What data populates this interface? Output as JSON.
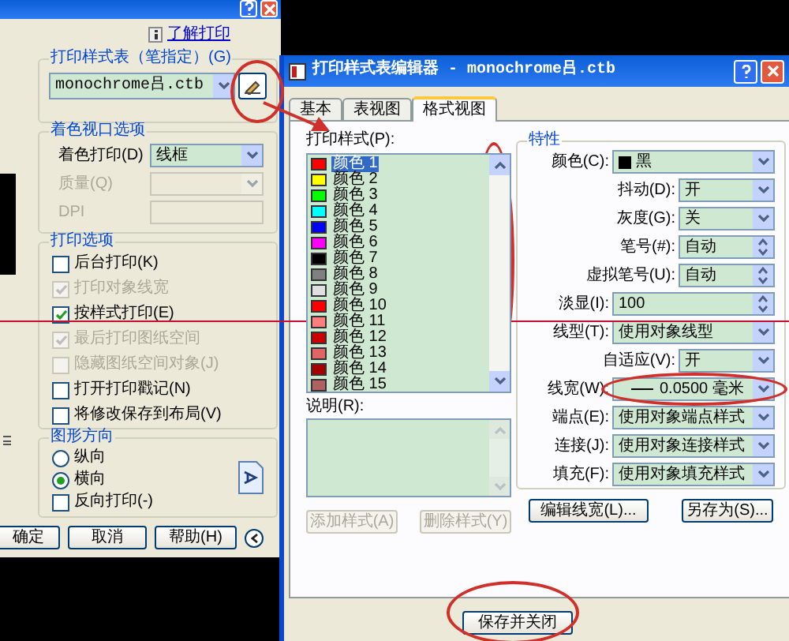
{
  "back_dialog": {
    "info_link": "了解打印",
    "plot_style_table": {
      "title": "打印样式表（笔指定）(G)",
      "value": "monochrome吕.ctb"
    },
    "shaded_viewport": {
      "title": "着色视口选项",
      "fields": [
        {
          "label": "着色打印(D)",
          "value": "线框",
          "disabled": false,
          "kind": "combo"
        },
        {
          "label": "质量(Q)",
          "disabled": true,
          "kind": "combo"
        },
        {
          "label": "DPI",
          "disabled": true,
          "kind": "text"
        }
      ]
    },
    "plot_options": {
      "title": "打印选项",
      "items": [
        {
          "label": "后台打印(K)",
          "checked": false,
          "disabled": false
        },
        {
          "label": "打印对象线宽",
          "checked": true,
          "disabled": true
        },
        {
          "label": "按样式打印(E)",
          "checked": true,
          "disabled": false
        },
        {
          "label": "最后打印图纸空间",
          "checked": true,
          "disabled": true
        },
        {
          "label": "隐藏图纸空间对象(J)",
          "checked": false,
          "disabled": true
        },
        {
          "label": "打开打印戳记(N)",
          "checked": false,
          "disabled": false
        },
        {
          "label": "将修改保存到布局(V)",
          "checked": false,
          "disabled": false
        }
      ]
    },
    "orientation": {
      "title": "图形方向",
      "options": [
        {
          "label": "纵向",
          "selected": false
        },
        {
          "label": "横向",
          "selected": true
        }
      ],
      "reverse": {
        "label": "反向打印(-)",
        "checked": false
      }
    },
    "buttons": [
      "确定",
      "取消",
      "帮助(H)"
    ]
  },
  "editor": {
    "title": "打印样式表编辑器 - monochrome吕.ctb",
    "tabs": [
      {
        "label": "基本",
        "selected": false
      },
      {
        "label": "表视图",
        "selected": false
      },
      {
        "label": "格式视图",
        "selected": true
      }
    ],
    "styles_label": "打印样式(P):",
    "styles": [
      {
        "name": "颜色 1",
        "color": "#ff0000",
        "selected": true
      },
      {
        "name": "颜色 2",
        "color": "#ffff00",
        "selected": false
      },
      {
        "name": "颜色 3",
        "color": "#00ff00",
        "selected": false
      },
      {
        "name": "颜色 4",
        "color": "#00ffff",
        "selected": false
      },
      {
        "name": "颜色 5",
        "color": "#0000ff",
        "selected": false
      },
      {
        "name": "颜色 6",
        "color": "#ff00ff",
        "selected": false
      },
      {
        "name": "颜色 7",
        "color": "#000000",
        "selected": false
      },
      {
        "name": "颜色 8",
        "color": "#808080",
        "selected": false
      },
      {
        "name": "颜色 9",
        "color": "#e0e0e0",
        "selected": false
      },
      {
        "name": "颜色 10",
        "color": "#ff0000",
        "selected": false
      },
      {
        "name": "颜色 11",
        "color": "#ff7f7f",
        "selected": false
      },
      {
        "name": "颜色 12",
        "color": "#cc0000",
        "selected": false
      },
      {
        "name": "颜色 13",
        "color": "#e06666",
        "selected": false
      },
      {
        "name": "颜色 14",
        "color": "#a50000",
        "selected": false
      },
      {
        "name": "颜色 15",
        "color": "#b06060",
        "selected": false
      }
    ],
    "description_label": "说明(R):",
    "list_buttons": [
      {
        "label": "添加样式(A)",
        "disabled": true
      },
      {
        "label": "删除样式(Y)",
        "disabled": true
      }
    ],
    "properties": {
      "title": "特性",
      "rows": [
        {
          "label": "颜色(C):",
          "value": "黑",
          "kind": "color"
        },
        {
          "label": "抖动(D):",
          "value": "开",
          "kind": "short-combo"
        },
        {
          "label": "灰度(G):",
          "value": "关",
          "kind": "short-combo"
        },
        {
          "label": "笔号(#):",
          "value": "自动",
          "kind": "short-spin"
        },
        {
          "label": "虚拟笔号(U):",
          "value": "自动",
          "kind": "short-spin"
        },
        {
          "label": "淡显(I):",
          "value": "100",
          "kind": "spin"
        },
        {
          "label": "线型(T):",
          "value": "使用对象线型",
          "kind": "combo"
        },
        {
          "label": "自适应(V):",
          "value": "开",
          "kind": "short-combo"
        },
        {
          "label": "线宽(W):",
          "value": "0.0500 毫米",
          "kind": "lineweight"
        },
        {
          "label": "端点(E):",
          "value": "使用对象端点样式",
          "kind": "combo"
        },
        {
          "label": "连接(J):",
          "value": "使用对象连接样式",
          "kind": "combo"
        },
        {
          "label": "填充(F):",
          "value": "使用对象填充样式",
          "kind": "combo"
        }
      ]
    },
    "buttons": [
      "编辑线宽(L)...",
      "另存为(S)..."
    ],
    "footer_button": "保存并关闭"
  },
  "annotations": [
    {
      "kind": "ellipse"
    },
    {
      "kind": "arrow"
    },
    {
      "kind": "ellipse"
    },
    {
      "kind": "line"
    },
    {
      "kind": "ellipse"
    },
    {
      "kind": "ellipse"
    }
  ]
}
